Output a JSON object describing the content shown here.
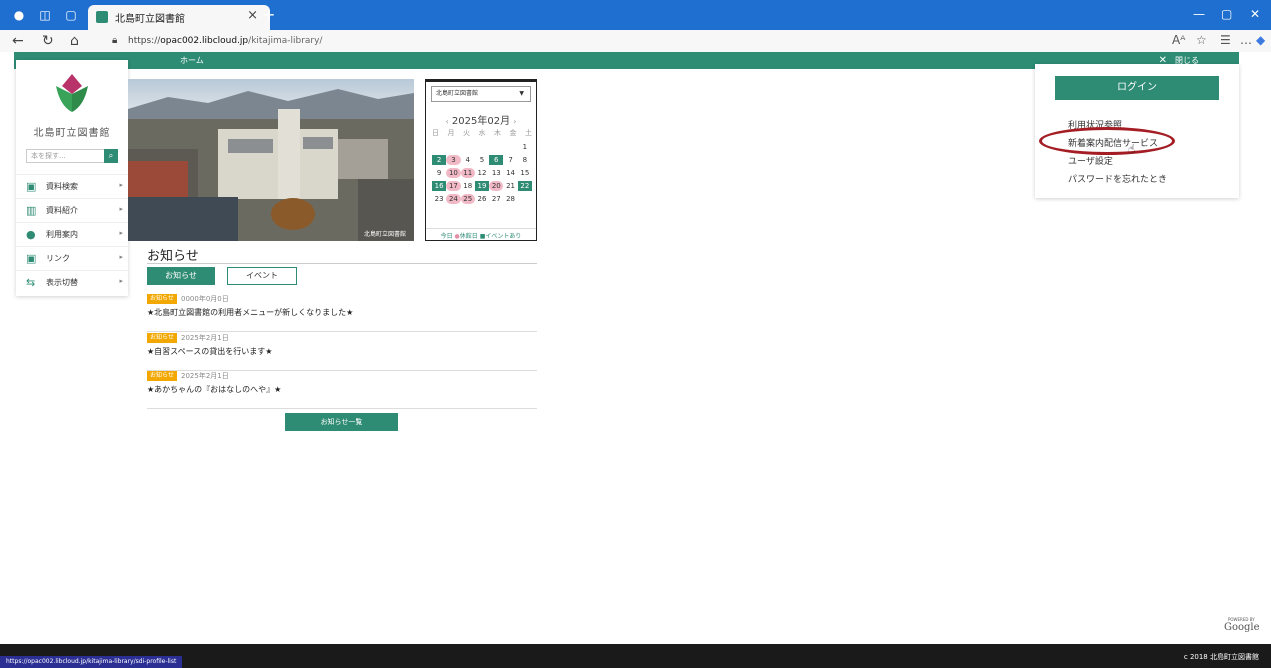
{
  "browser": {
    "tab_title": "北島町立図書館",
    "url_prefix": "https://",
    "url_host": "opac002.libcloud.jp",
    "url_path": "/kitajima-library/",
    "status_url": "https://opac002.libcloud.jp/kitajima-library/sdi-profile-list"
  },
  "menubar": {
    "home": "ホーム",
    "close": "閉じる"
  },
  "sidebar": {
    "library_name": "北島町立図書館",
    "search_placeholder": "本を探す...",
    "items": [
      {
        "label": "資料検索",
        "icon": "search-book-icon"
      },
      {
        "label": "資料紹介",
        "icon": "book-open-icon"
      },
      {
        "label": "利用案内",
        "icon": "person-icon"
      },
      {
        "label": "リンク",
        "icon": "link-icon"
      },
      {
        "label": "表示切替",
        "icon": "switch-icon"
      }
    ]
  },
  "hero": {
    "caption": "北島町立図書館"
  },
  "calendar": {
    "library_select": "北島町立図書館",
    "month": "2025年02月",
    "weekdays": [
      "日",
      "月",
      "火",
      "水",
      "木",
      "金",
      "土"
    ],
    "legend_today": "今日",
    "legend_closed": "休館日",
    "legend_event": "イベントあり"
  },
  "news": {
    "heading": "お知らせ",
    "tab_news": "お知らせ",
    "tab_event": "イベント",
    "items": [
      {
        "badge": "お知らせ",
        "date": "0000年0月0日",
        "title": "★北島町立図書館の利用者メニューが新しくなりました★"
      },
      {
        "badge": "お知らせ",
        "date": "2025年2月1日",
        "title": "★自習スペースの貸出を行います★"
      },
      {
        "badge": "お知らせ",
        "date": "2025年2月1日",
        "title": "★あかちゃんの『おはなしのへや』★"
      }
    ],
    "more": "お知らせ一覧"
  },
  "login": {
    "button": "ログイン",
    "links": [
      "利用状況参照",
      "新着案内配信サービス",
      "ユーザ設定",
      "パスワードを忘れたとき"
    ]
  },
  "google": {
    "powered": "POWERED BY",
    "label": "Google"
  },
  "footer": {
    "copyright": "c 2018 北島町立図書館"
  },
  "colors": {
    "accent": "#2e8b74",
    "badge": "#f2a800",
    "highlight_ring": "#a51d24",
    "titlebar": "#1f6fd1"
  }
}
